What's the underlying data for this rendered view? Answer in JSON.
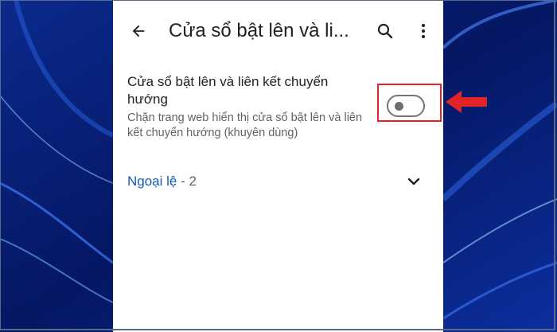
{
  "app": {
    "title": "Cửa sổ bật lên và li..."
  },
  "appbar": {
    "back_icon": "arrow-back-icon",
    "search_icon": "search-icon",
    "more_icon": "more-vert-icon"
  },
  "setting": {
    "title": "Cửa sổ bật lên và liên kết chuyển hướng",
    "description": "Chặn trang web hiển thị cửa sổ bật lên và liên kết chuyển hướng (khuyên dùng)",
    "toggle_on": false
  },
  "exceptions": {
    "label": "Ngoại lệ",
    "count": " - 2",
    "icon": "chevron-down-icon"
  },
  "colors": {
    "highlight": "#e0242a",
    "link": "#1558b0",
    "wallpaper": "#071a66"
  }
}
